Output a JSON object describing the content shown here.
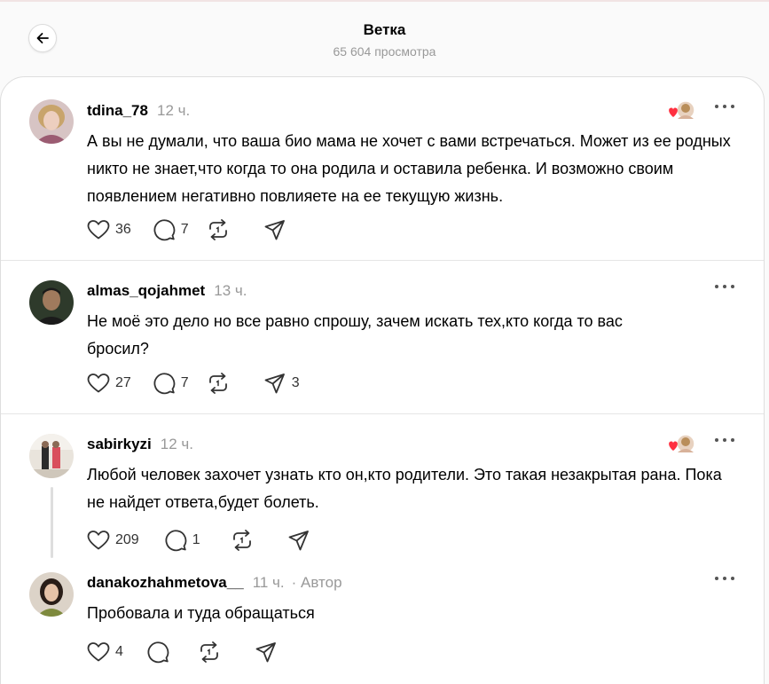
{
  "header": {
    "title": "Ветка",
    "subtitle": "65 604 просмотра"
  },
  "posts": [
    {
      "username": "tdina_78",
      "time": "12 ч.",
      "text": "А вы не думали, что ваша био мама не хочет с вами встречаться. Может из ее родных никто не знает,что когда то она родила и оставила ребенка. И возможно своим появлением негативно повлияете на ее текущую жизнь.",
      "likes": "36",
      "replies": "7",
      "shares": "",
      "liked_by_author": true
    },
    {
      "username": "almas_qojahmet",
      "time": "13 ч.",
      "text": "Не моё это дело но все равно спрошу, зачем искать тех,кто когда то вас бросил?",
      "likes": "27",
      "replies": "7",
      "shares": "3",
      "liked_by_author": false
    },
    {
      "username": "sabirkyzi",
      "time": "12 ч.",
      "text": "Любой человек захочет узнать кто он,кто родители. Это такая незакрытая рана. Пока не найдет ответа,будет болеть.",
      "likes": "209",
      "replies": "1",
      "shares": "",
      "liked_by_author": true
    },
    {
      "username": "danakozhahmetova__",
      "time": "11 ч.",
      "author_label": "· Автор",
      "text": "Пробовала и туда обращаться",
      "likes": "4",
      "replies": "",
      "shares": "",
      "liked_by_author": false
    }
  ],
  "icons": {
    "back": "arrow-left-icon",
    "like": "heart-icon",
    "reply": "comment-icon",
    "repost": "repost-icon",
    "share": "send-icon",
    "more": "more-icon"
  },
  "colors": {
    "accent_heart": "#ff3040",
    "muted_text": "#999999",
    "divider": "#e5e5e5"
  }
}
